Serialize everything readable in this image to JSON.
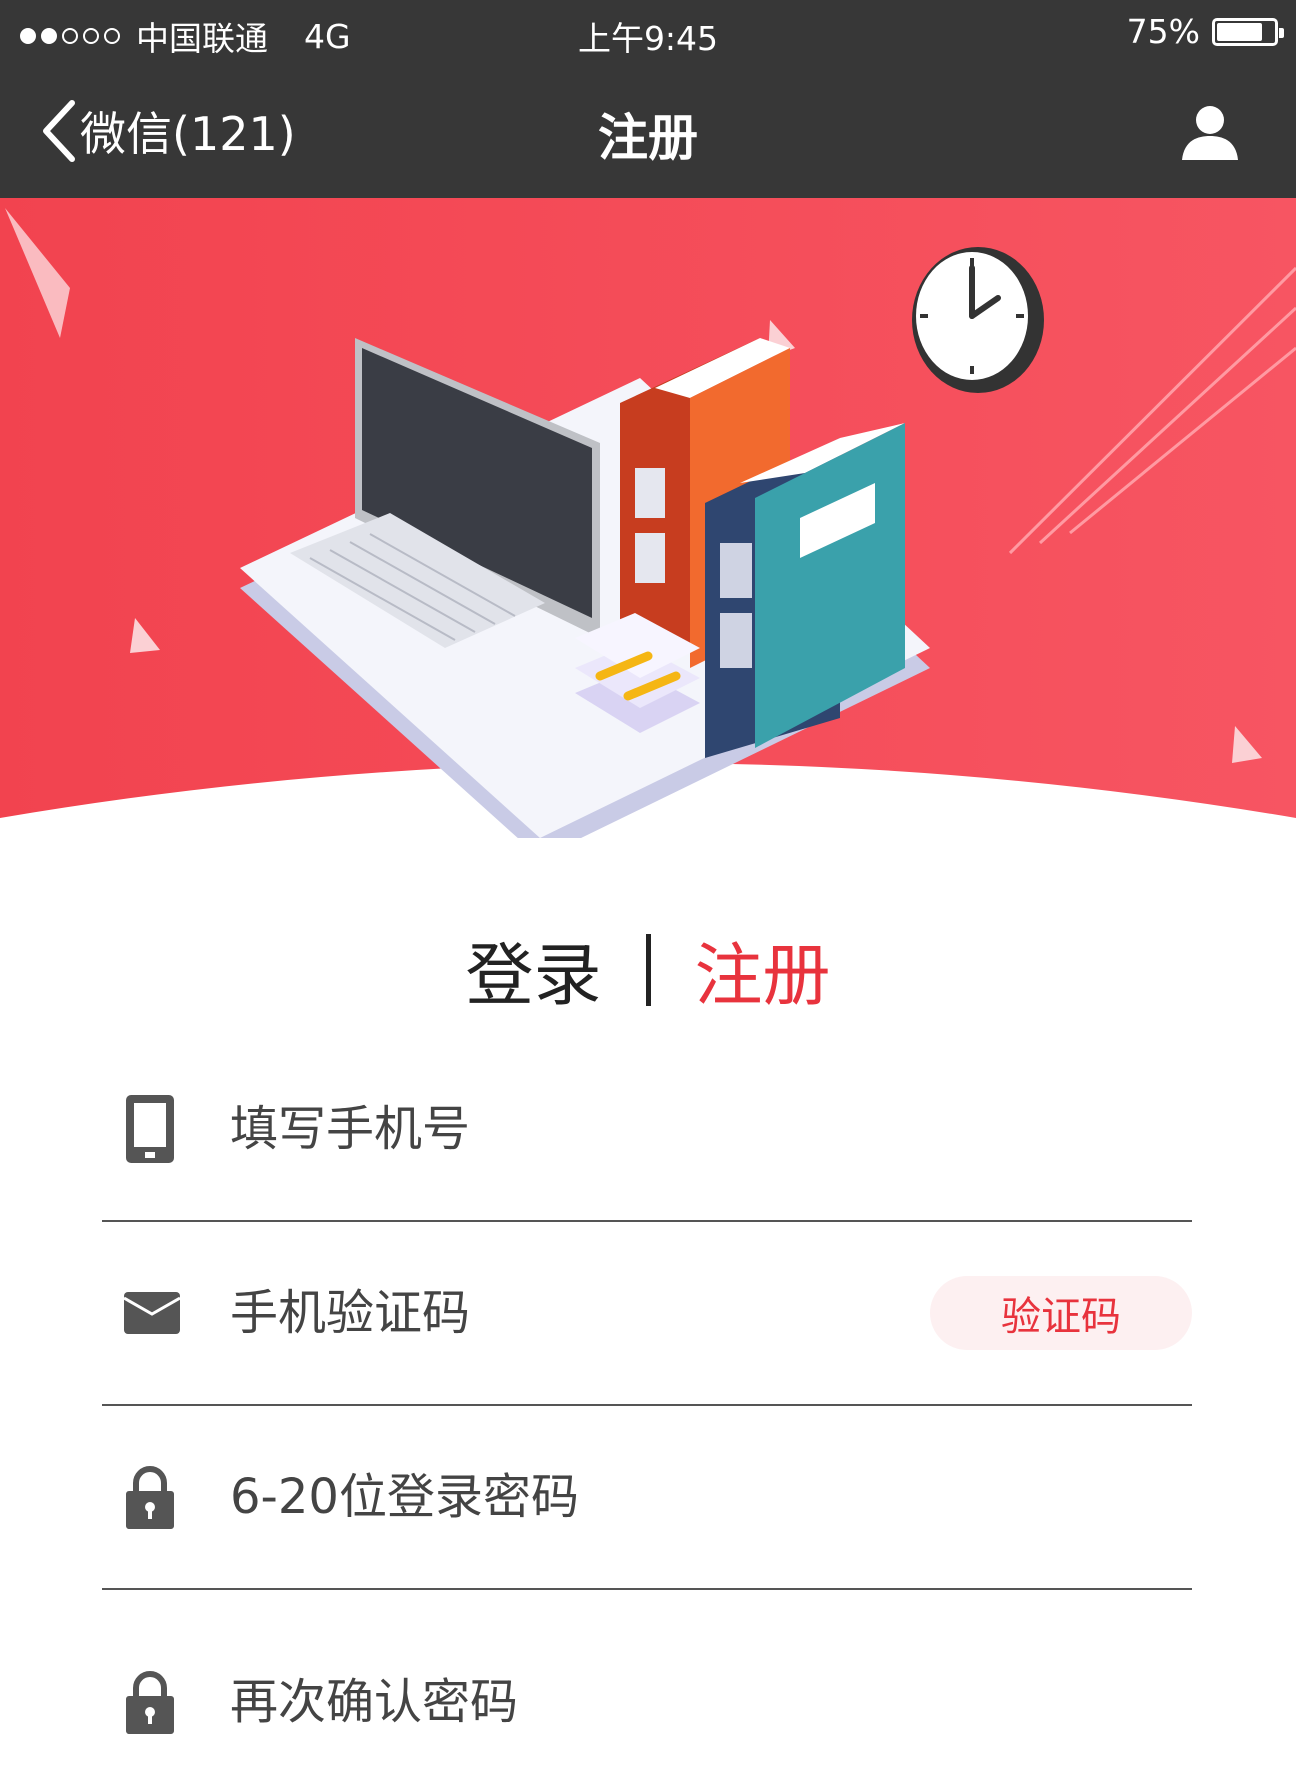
{
  "status_bar": {
    "carrier": "中国联通",
    "network": "4G",
    "time": "上午9:45",
    "battery_percent_text": "75%",
    "battery_level": 0.75
  },
  "nav": {
    "back_label": "微信(121)",
    "title": "注册",
    "back_icon": "chevron-left-icon",
    "profile_icon": "user-icon"
  },
  "tabs": {
    "login": "登录",
    "register": "注册",
    "active": "register"
  },
  "form": {
    "phone_placeholder": "填写手机号",
    "code_placeholder": "手机验证码",
    "code_button": "验证码",
    "password_placeholder": "6-20位登录密码",
    "confirm_placeholder": "再次确认密码"
  },
  "colors": {
    "accent": "#e8333d",
    "header_bg": "#373737",
    "hero_bg": "#f04a55"
  }
}
